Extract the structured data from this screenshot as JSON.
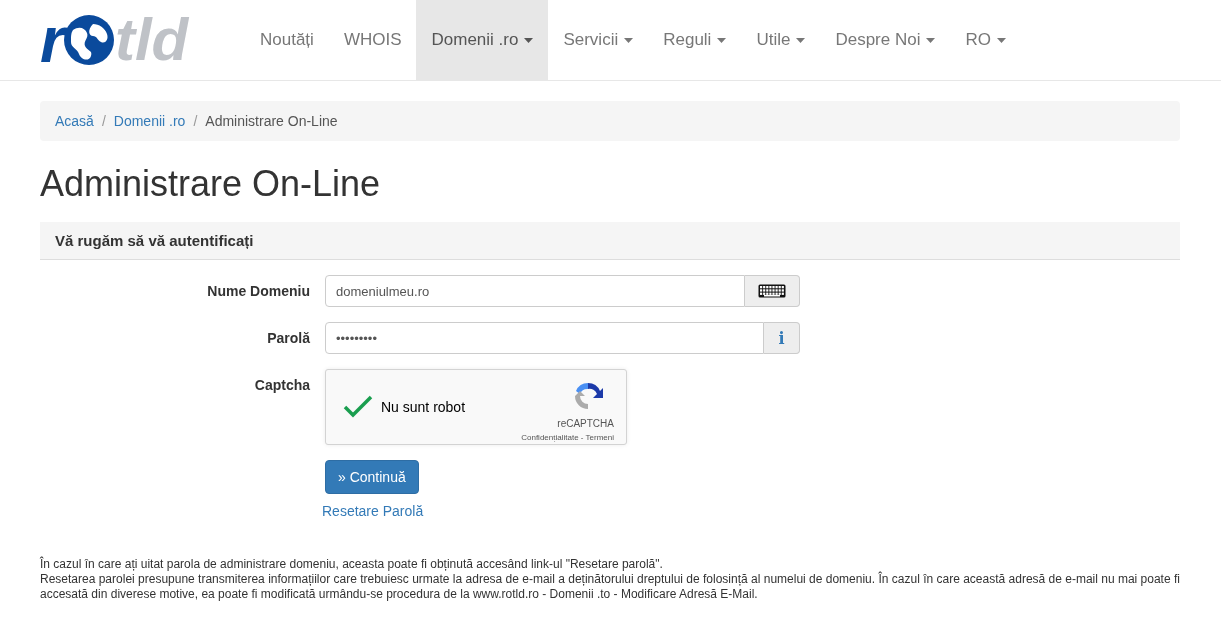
{
  "logo": {
    "text_start": "r",
    "text_end": "tld"
  },
  "nav": [
    {
      "label": "Noutăți",
      "dropdown": false,
      "selected": false
    },
    {
      "label": "WHOIS",
      "dropdown": false,
      "selected": false
    },
    {
      "label": "Domenii .ro",
      "dropdown": true,
      "selected": true
    },
    {
      "label": "Servicii",
      "dropdown": true,
      "selected": false
    },
    {
      "label": "Reguli",
      "dropdown": true,
      "selected": false
    },
    {
      "label": "Utile",
      "dropdown": true,
      "selected": false
    },
    {
      "label": "Despre Noi",
      "dropdown": true,
      "selected": false
    },
    {
      "label": "RO",
      "dropdown": true,
      "selected": false
    }
  ],
  "breadcrumb": {
    "separator": "/",
    "items": [
      "Acasă",
      "Domenii .ro",
      "Administrare On-Line"
    ]
  },
  "title": "Administrare On-Line",
  "panel": {
    "heading": "Vă rugăm să vă autentificați",
    "fields": [
      {
        "label": "Nume Domeniu",
        "value": "domeniulmeu.ro",
        "kind": "keyboard"
      },
      {
        "label": "Parolă",
        "value": "•••••••••",
        "kind": "info",
        "addon_text": "i"
      }
    ],
    "captcha": {
      "label": "Captcha",
      "checked": true,
      "text": "Nu sunt robot",
      "brand": "reCAPTCHA",
      "links": "Confidențialitate - Termeni"
    },
    "submit": "» Continuă",
    "reset_link": "Resetare Parolă"
  },
  "notes": [
    "În cazul în care ați uitat parola de administrare domeniu, aceasta poate fi obținută accesând link-ul \"Resetare parolă\".",
    "Resetarea parolei presupune transmiterea informațiilor care trebuiesc urmate la adresa de e-mail a deținătorului dreptului de folosință al numelui de domeniu. În cazul în care această adresă de e-mail nu mai poate fi accesată din diverese motive, ea poate fi modificată urmându-se procedura de la www.rotld.ro - Domenii .to - Modificare Adresă E-Mail."
  ]
}
